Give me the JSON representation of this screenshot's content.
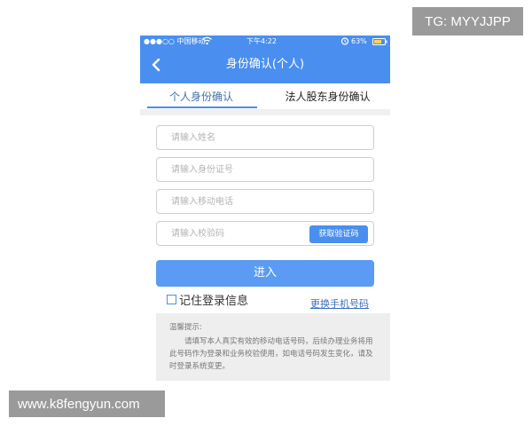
{
  "status_bar": {
    "carrier": "●●●○○ 中国移动",
    "time": "下午4:22",
    "battery": "63%"
  },
  "nav": {
    "title": "身份确认(个人)",
    "back_icon": "chevron-left-icon"
  },
  "tabs": [
    {
      "label": "个人身份确认",
      "active": true
    },
    {
      "label": "法人股东身份确认",
      "active": false
    }
  ],
  "form": {
    "name_placeholder": "请输入姓名",
    "id_placeholder": "请输入身份证号",
    "phone_placeholder": "请输入移动电话",
    "code_placeholder": "请输入校验码",
    "get_code_label": "获取验证码",
    "submit_label": "进入",
    "remember_label": "记住登录信息",
    "change_phone_label": "更换手机号码"
  },
  "tips": {
    "title": "温馨提示:",
    "body": "请填写本人真实有效的移动电话号码，后续办理业务将用此号码作为登录和业务校验使用，如电话号码发生变化，请及时登录系统变更。"
  },
  "overlays": {
    "tg": "TG: MYYJJPP",
    "site": "www.k8fengyun.com"
  },
  "colors": {
    "primary": "#4a8ff0",
    "button": "#5b9bf3",
    "link": "#3b6fc0",
    "tips_bg": "#eeeeee"
  }
}
